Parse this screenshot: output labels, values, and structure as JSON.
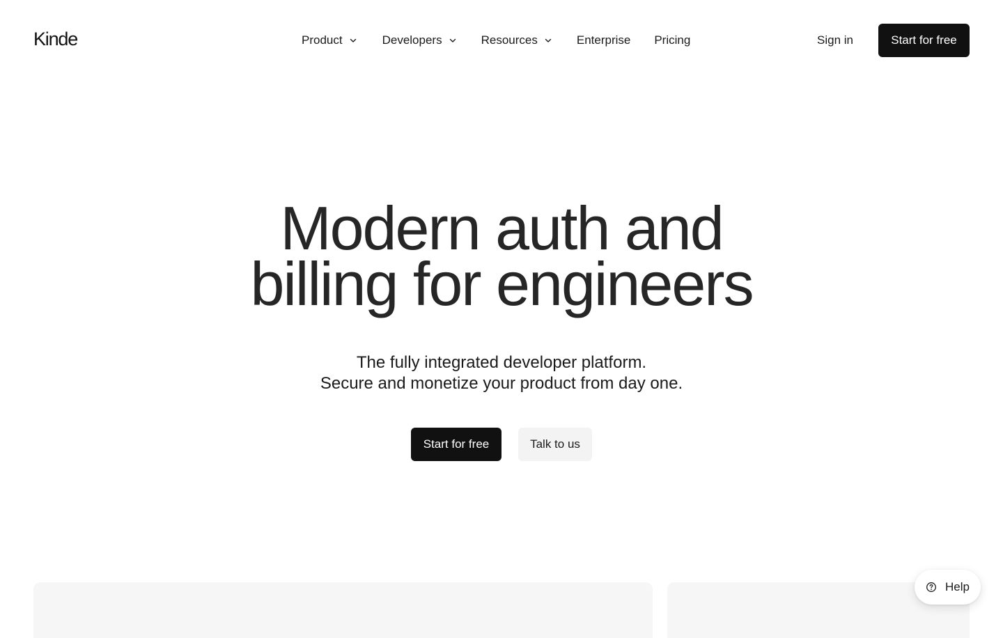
{
  "brand": {
    "logo_text": "Kinde"
  },
  "nav": {
    "items": [
      {
        "label": "Product",
        "has_dropdown": true
      },
      {
        "label": "Developers",
        "has_dropdown": true
      },
      {
        "label": "Resources",
        "has_dropdown": true
      },
      {
        "label": "Enterprise",
        "has_dropdown": false
      },
      {
        "label": "Pricing",
        "has_dropdown": false
      }
    ],
    "sign_in_label": "Sign in",
    "cta_label": "Start for free"
  },
  "hero": {
    "title_line1": "Modern auth and",
    "title_line2": "billing for engineers",
    "subtitle_line1": "The fully integrated developer platform.",
    "subtitle_line2": "Secure and monetize your product from day one.",
    "primary_cta": "Start for free",
    "secondary_cta": "Talk to us"
  },
  "help_widget": {
    "label": "Help",
    "icon": "question-circle-icon"
  },
  "colors": {
    "primary_button_bg": "#111111",
    "secondary_button_bg": "#f3f3f3",
    "panel_bg": "#f6f6f6",
    "text": "#1a1a1a"
  }
}
